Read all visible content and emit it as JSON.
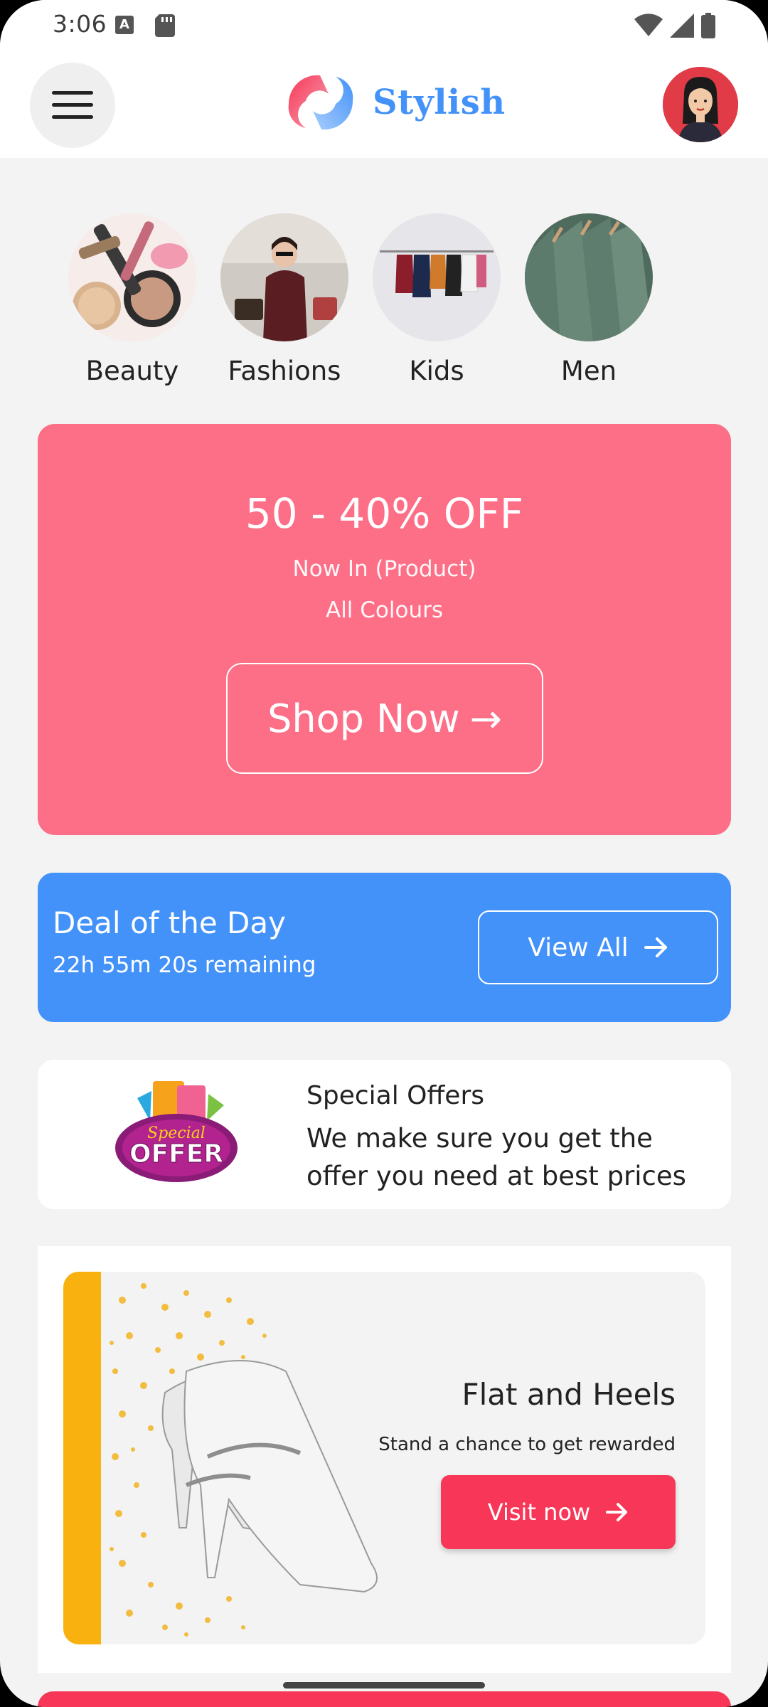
{
  "status_bar": {
    "time": "3:06",
    "notification_icons": [
      "keyboard-a-icon",
      "sd-card-icon"
    ],
    "system_icons": [
      "wifi-icon",
      "signal-icon",
      "battery-icon"
    ]
  },
  "header": {
    "brand_name": "Stylish",
    "brand_color": "#4392f9",
    "menu_icon": "hamburger-icon"
  },
  "categories": [
    {
      "label": "Beauty"
    },
    {
      "label": "Fashions"
    },
    {
      "label": "Kids"
    },
    {
      "label": "Men"
    }
  ],
  "promo": {
    "title": "50 - 40% OFF",
    "subtitle": "Now In (Product)",
    "subtitle2": "All Colours",
    "button_label": "Shop Now",
    "button_arrow": "→",
    "color": "#fd6e87"
  },
  "deal": {
    "title": "Deal of the Day",
    "timer": "22h 55m 20s remaining",
    "button_label": "View All",
    "color": "#4392f9"
  },
  "special_offers": {
    "title": "Special Offers",
    "description": "We make sure you get the offer you need at best prices",
    "logo_text_top": "Special",
    "logo_text_bottom": "OFFER"
  },
  "heels": {
    "title": "Flat and Heels",
    "subtitle": "Stand a chance to get rewarded",
    "button_label": "Visit now",
    "accent_color": "#f9b110",
    "button_color": "#f83758"
  }
}
